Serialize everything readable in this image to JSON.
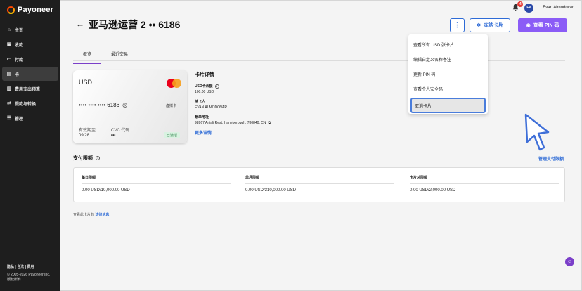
{
  "brand": {
    "name": "Payoneer"
  },
  "sidebar": {
    "items": [
      {
        "icon": "home-icon",
        "label": "主页"
      },
      {
        "icon": "inbox-icon",
        "label": "收款"
      },
      {
        "icon": "payment-icon",
        "label": "付款"
      },
      {
        "icon": "card-icon",
        "label": "卡",
        "active": true
      },
      {
        "icon": "budget-icon",
        "label": "费用支出预算"
      },
      {
        "icon": "exchange-icon",
        "label": "提款与转换"
      },
      {
        "icon": "menu-icon",
        "label": "管理"
      }
    ],
    "footer": {
      "links": "隐私 | 合法 | 费用",
      "copyright": "© 2005-2026 Payoneer Inc.",
      "rights": "版权所有"
    }
  },
  "topbar": {
    "notification_count": "4",
    "avatar_initials": "EA",
    "user_name": "Evan Almodovar"
  },
  "page": {
    "title": "亚马逊运营 2 •• 6186",
    "more_label": "⋮",
    "freeze_label": "冻结卡片",
    "pin_label": "查看 PIN 码"
  },
  "tabs": [
    {
      "label": "概览",
      "active": true
    },
    {
      "label": "最近交易"
    }
  ],
  "card": {
    "currency": "USD",
    "number": "•••• •••• •••• 6186",
    "type": "虚拟卡",
    "expiry_label": "有效期至",
    "expiry": "09/28",
    "cvc_label": "CVC 代码",
    "cvc": "•••",
    "status": "已激活"
  },
  "details": {
    "title": "卡片详情",
    "balance_label": "USD卡余额",
    "balance": "100.00 USD",
    "holder_label": "持卡人",
    "holder": "EVAN ALMODOVAR",
    "address_label": "账单地址",
    "address": "98967 Anjali Rest, Haneborough, 780840, CN",
    "more_link": "更多详情"
  },
  "limits": {
    "title": "支付限额",
    "manage_link": "管理支付限额",
    "columns": [
      {
        "label": "每日限额",
        "value": "0.00 USD/10,000.00 USD"
      },
      {
        "label": "单月限额",
        "value": "0.00 USD/310,000.00 USD"
      },
      {
        "label": "卡片总限额",
        "value": "0.00 USD/2,000.00 USD"
      }
    ]
  },
  "legal": {
    "prefix": "查看此卡片的",
    "link": "法律信息"
  },
  "dropdown": {
    "items": [
      "查看所有 USD 张卡片",
      "编辑自定义名称备注",
      "更新 PIN 码",
      "查看个人安全码",
      "取消卡片"
    ]
  },
  "colors": {
    "accent": "#8b5cf6",
    "link": "#2e6bd6",
    "sidebar": "#1e1e1e",
    "status_ok": "#1f7a3d"
  }
}
